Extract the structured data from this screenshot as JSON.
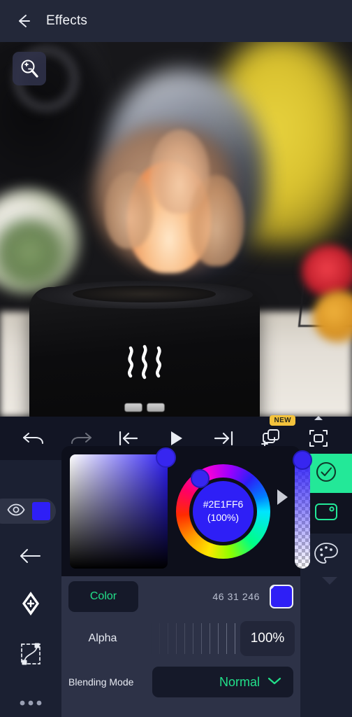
{
  "header": {
    "title": "Effects",
    "back_icon": "back-arrow-icon"
  },
  "preview": {
    "zoom_icon": "zoom-in-out-icon",
    "description": "Flame-effect aroma diffuser video frame"
  },
  "toolbar": {
    "items": [
      {
        "name": "undo-button",
        "icon": "undo-icon",
        "enabled": true
      },
      {
        "name": "redo-button",
        "icon": "redo-icon",
        "enabled": false
      },
      {
        "name": "skip-to-start-button",
        "icon": "skip-to-start-icon",
        "enabled": true
      },
      {
        "name": "play-button",
        "icon": "play-icon",
        "enabled": true
      },
      {
        "name": "skip-to-end-button",
        "icon": "skip-to-end-icon",
        "enabled": true
      },
      {
        "name": "add-layer-button",
        "icon": "add-layer-icon",
        "enabled": true
      },
      {
        "name": "crop-frame-button",
        "icon": "crop-frame-icon",
        "enabled": true
      }
    ],
    "new_badge": "NEW"
  },
  "left_rail": {
    "visibility_toggle": {
      "icon": "eye-icon",
      "chip_color": "#2E1FF6"
    },
    "items": [
      {
        "name": "back-button",
        "icon": "arrow-left-icon"
      },
      {
        "name": "keyframe-button",
        "icon": "keyframe-diamond-icon"
      },
      {
        "name": "bezier-curve-button",
        "icon": "bezier-curve-icon"
      },
      {
        "name": "more-options-button",
        "icon": "more-dots-icon"
      }
    ]
  },
  "right_rail": {
    "confirm": {
      "icon": "check-circle-icon",
      "color": "#23E898"
    },
    "screen_picker": {
      "icon": "screen-picker-icon",
      "color": "#23E898"
    },
    "palette": {
      "icon": "palette-icon"
    }
  },
  "color_picker": {
    "hex": "#2E1FF6",
    "opacity_label": "(100%)",
    "expand_icon": "expand-triangle-icon",
    "sv_square_name": "saturation-value-square",
    "hue_ring_name": "hue-ring",
    "alpha_slider_name": "alpha-vertical-slider"
  },
  "controls": {
    "color_row": {
      "label": "Color",
      "rgb": "46 31 246",
      "swatch_color": "#2E1FF6"
    },
    "alpha_row": {
      "label": "Alpha",
      "value": "100%",
      "indicator_color": "#44E39A"
    },
    "blending_row": {
      "label": "Blending Mode",
      "value": "Normal",
      "chevron_icon": "chevron-down-icon"
    }
  },
  "colors": {
    "accent_green": "#23E898",
    "panel_bg": "#2D3247",
    "dark_bg": "#141828",
    "header_bg": "#232839",
    "brand_blue": "#2E1FF6",
    "badge_amber": "#F3C23C"
  }
}
